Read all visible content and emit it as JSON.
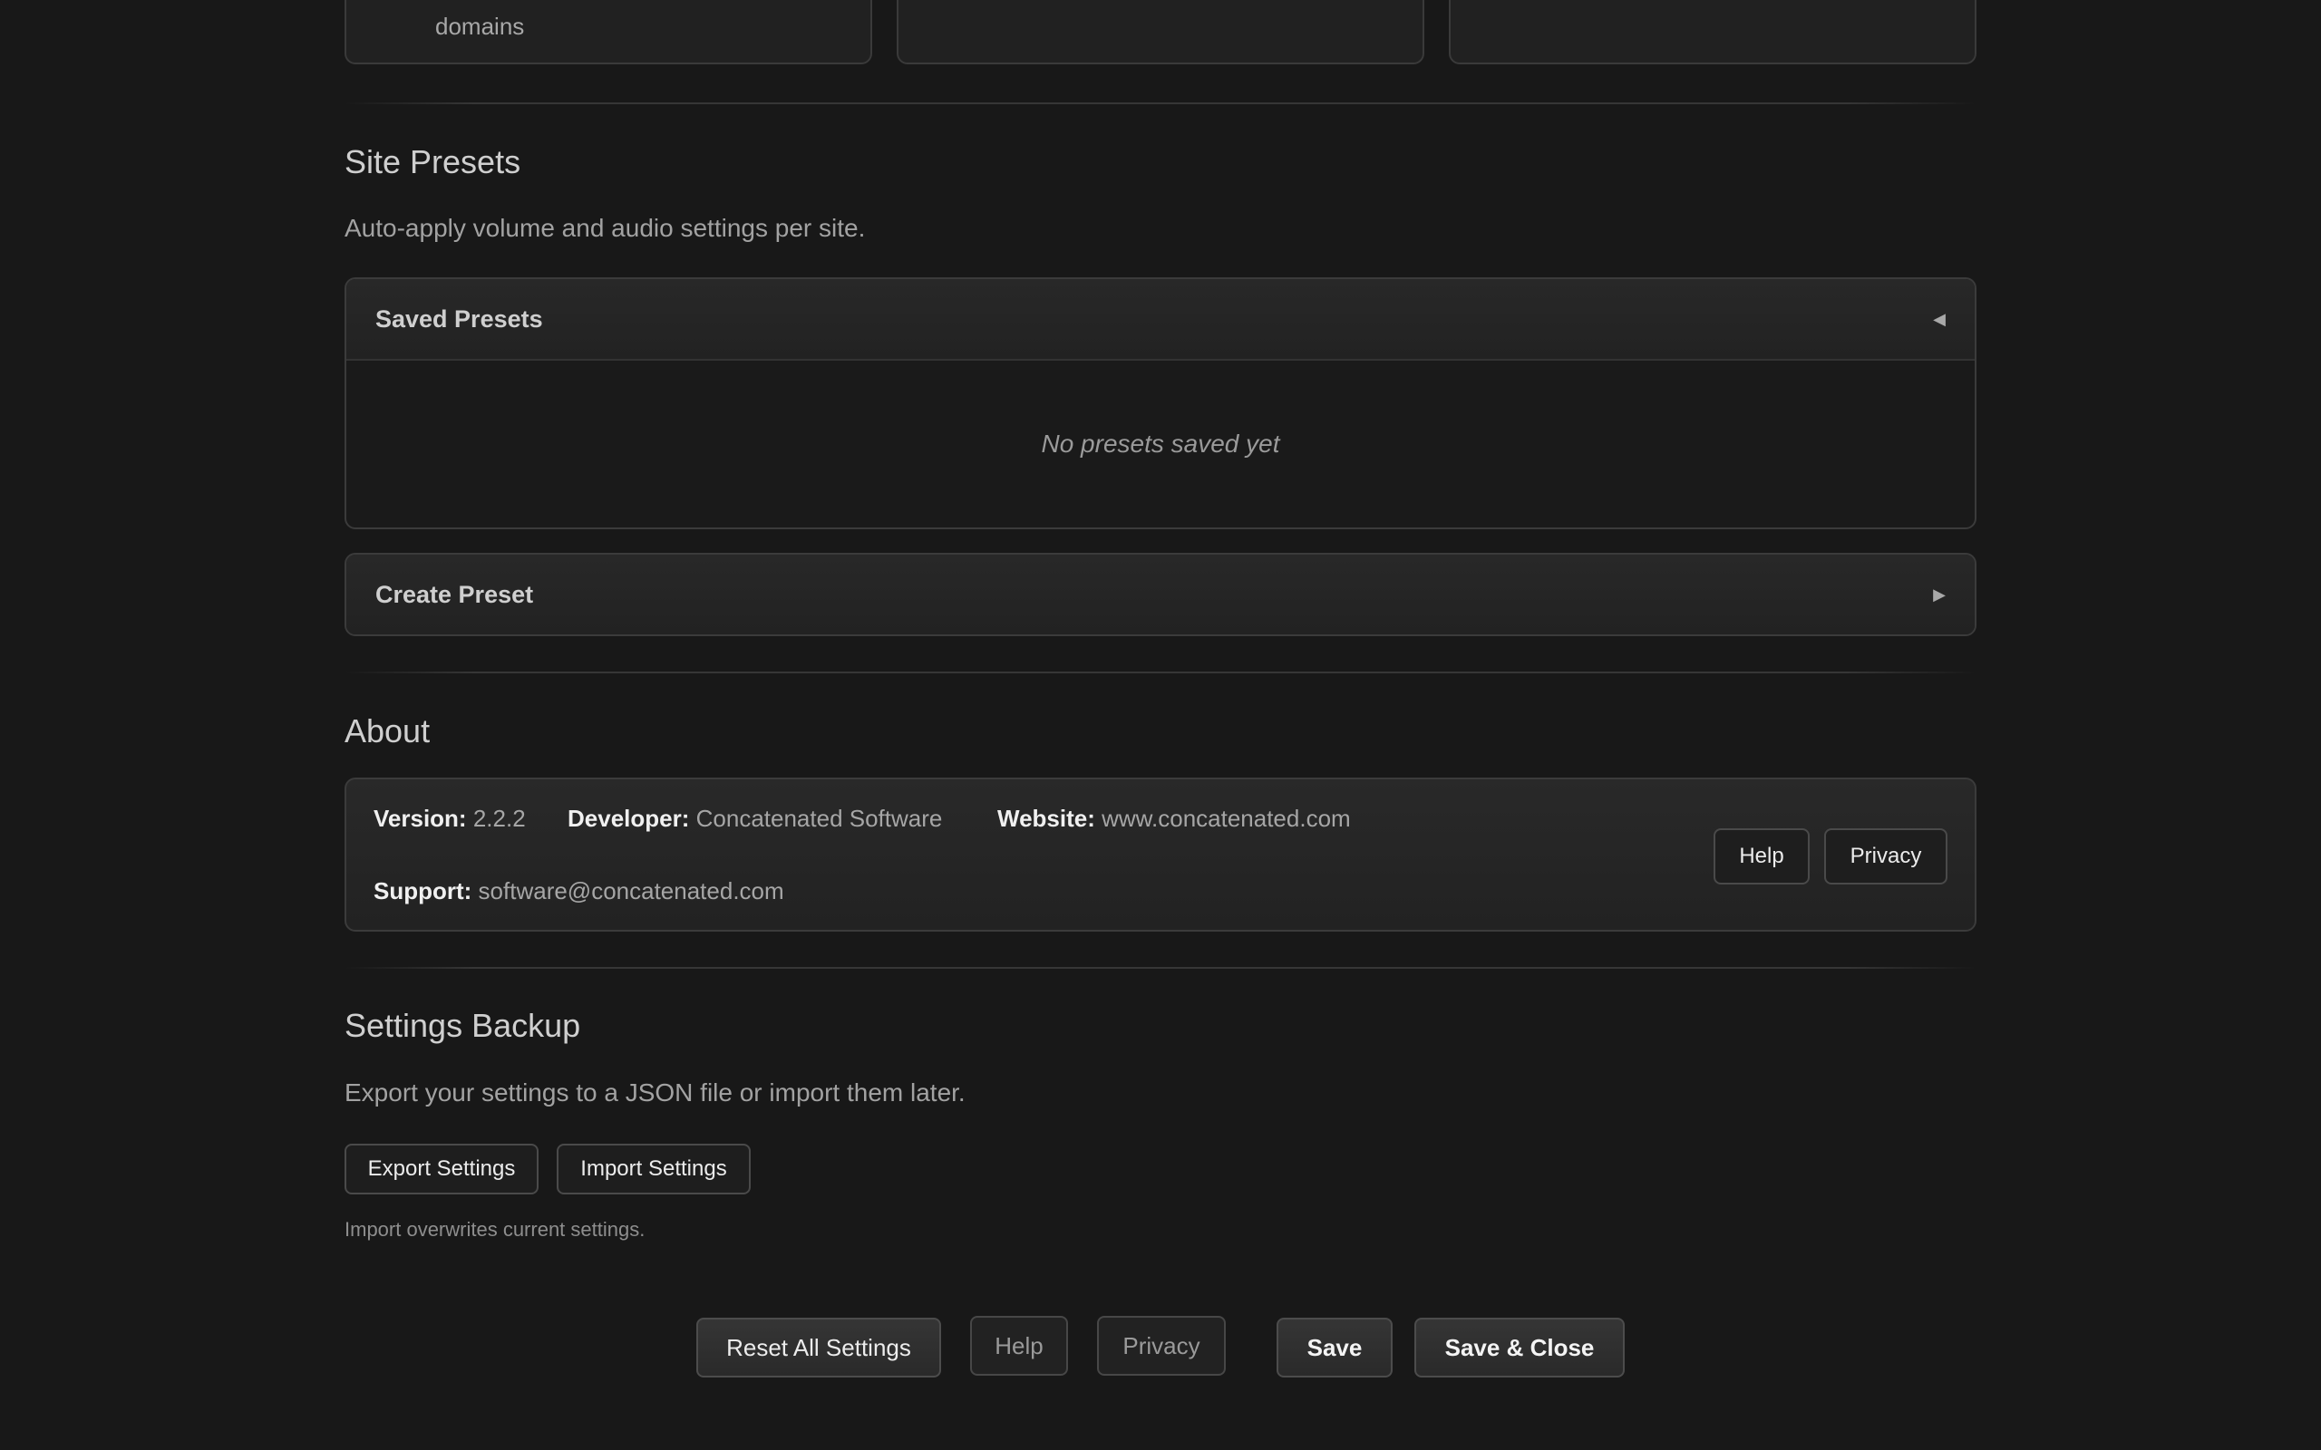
{
  "top_cards": {
    "card1_text": "domains"
  },
  "site_presets": {
    "title": "Site Presets",
    "description": "Auto-apply volume and audio settings per site.",
    "saved_panel": {
      "title": "Saved Presets",
      "arrow": "◀",
      "empty_text": "No presets saved yet"
    },
    "create_panel": {
      "title": "Create Preset",
      "arrow": "▶"
    }
  },
  "about": {
    "title": "About",
    "version_label": "Version:",
    "version_value": "2.2.2",
    "developer_label": "Developer:",
    "developer_value": "Concatenated Software",
    "website_label": "Website:",
    "website_value": "www.concatenated.com",
    "support_label": "Support:",
    "support_value": "software@concatenated.com",
    "help_label": "Help",
    "privacy_label": "Privacy"
  },
  "backup": {
    "title": "Settings Backup",
    "description": "Export your settings to a JSON file or import them later.",
    "export_label": "Export Settings",
    "import_label": "Import Settings",
    "note": "Import overwrites current settings."
  },
  "footer": {
    "reset_label": "Reset All Settings",
    "help_label": "Help",
    "privacy_label": "Privacy",
    "save_label": "Save",
    "save_close_label": "Save & Close"
  }
}
